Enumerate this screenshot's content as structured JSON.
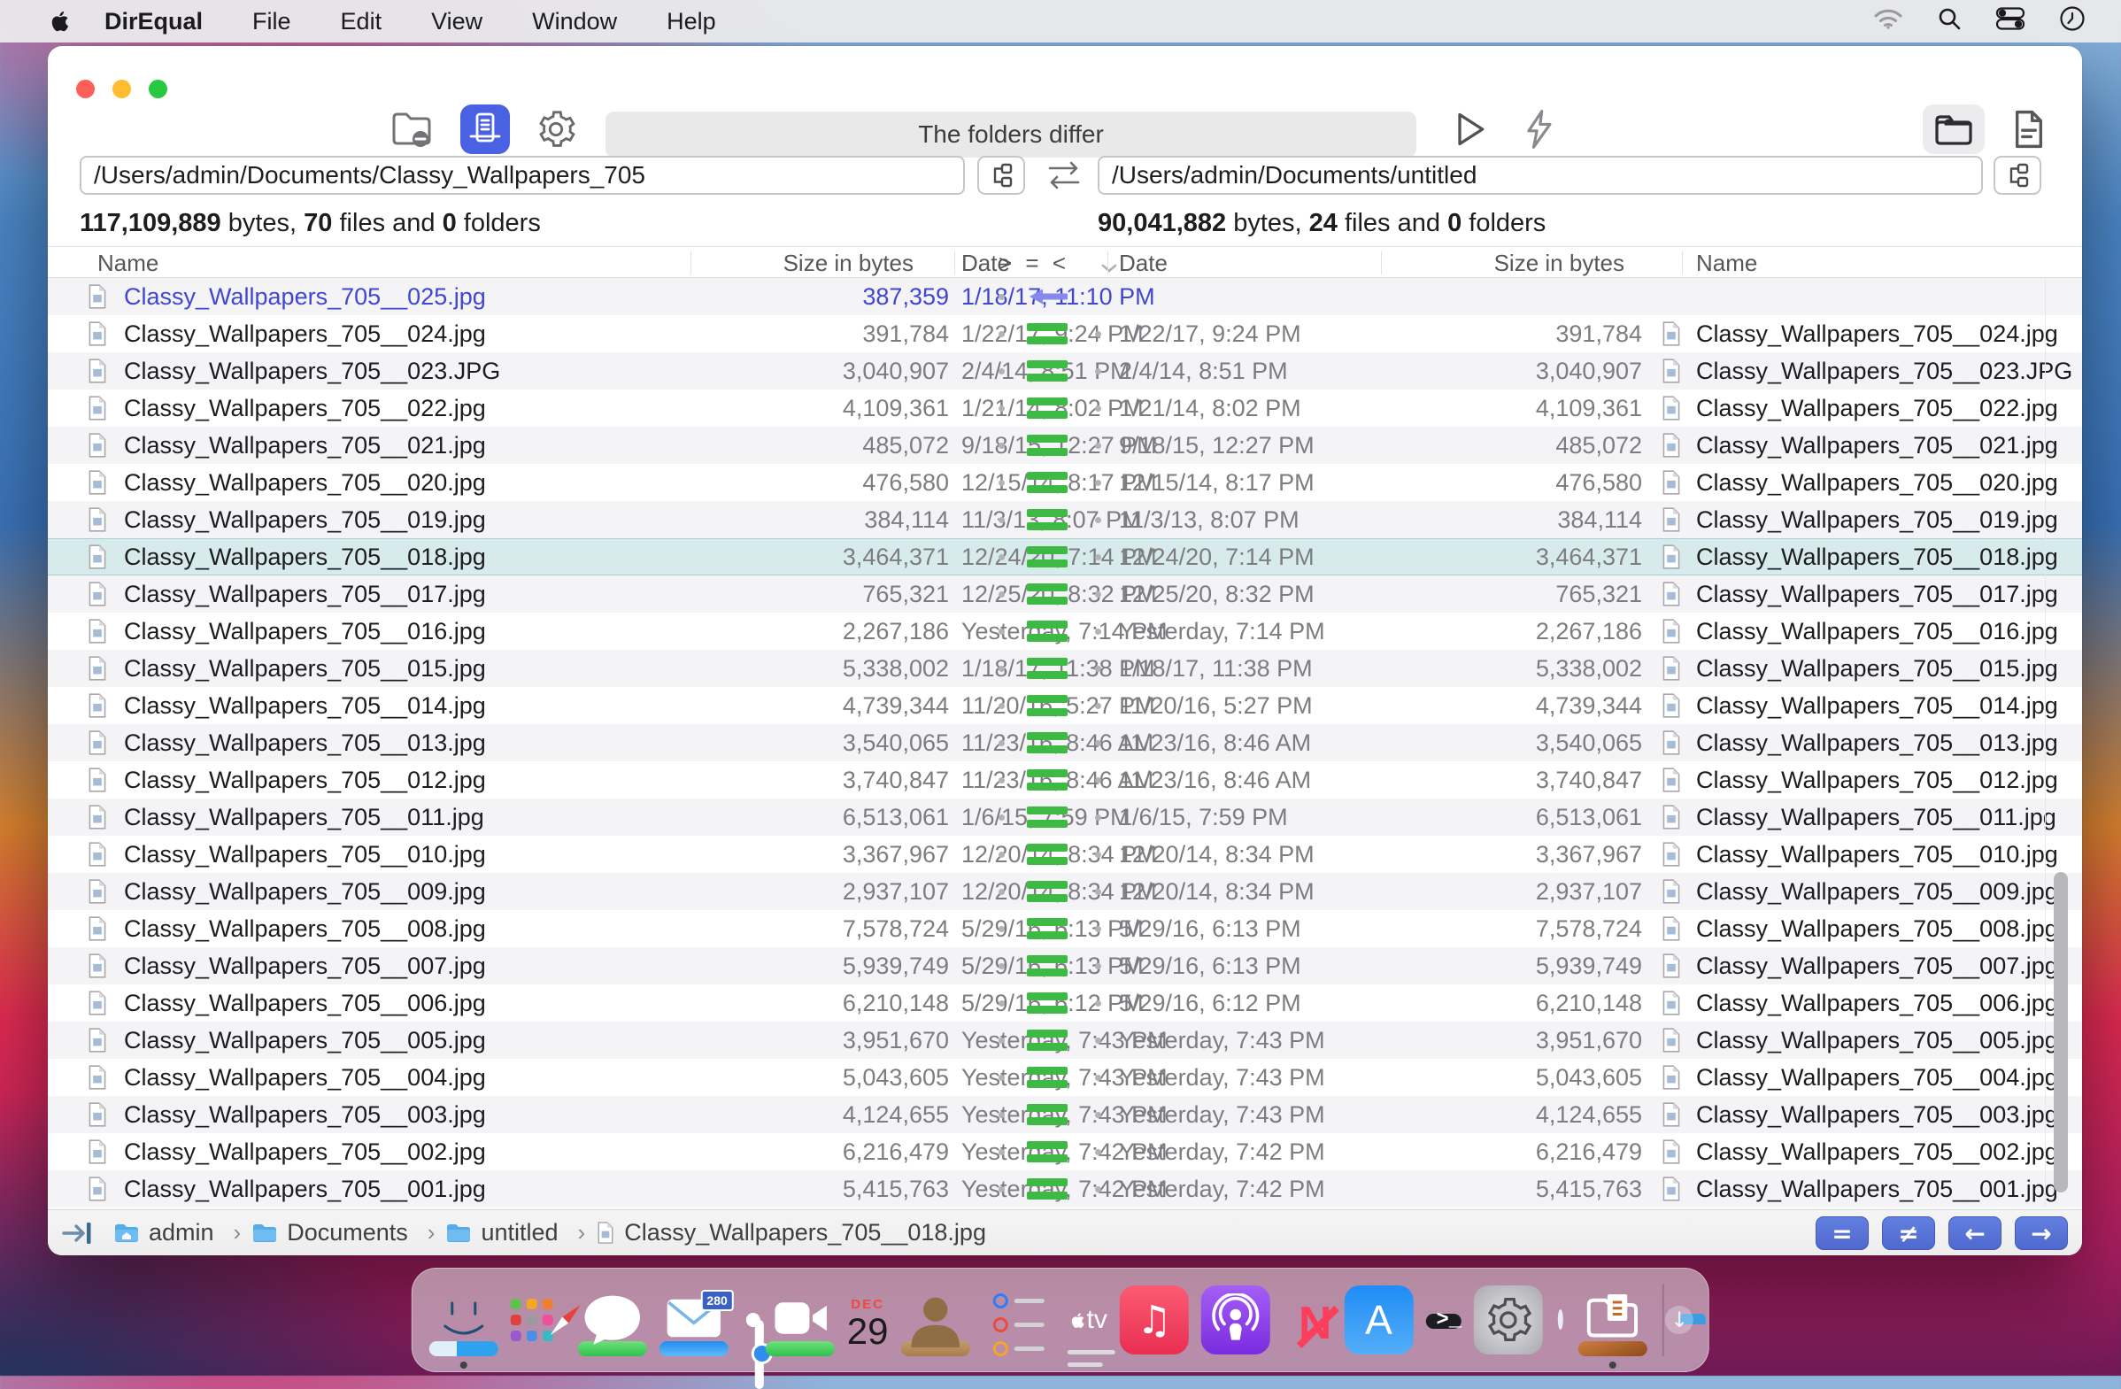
{
  "menu_bar": {
    "app_name": "DirEqual",
    "items": [
      "File",
      "Edit",
      "View",
      "Window",
      "Help"
    ]
  },
  "toolbar": {
    "status_title": "The folders differ"
  },
  "panes": {
    "left": {
      "path": "/Users/admin/Documents/Classy_Wallpapers_705",
      "bytes": "117,109,889",
      "bytes_label": "bytes,",
      "files": "70",
      "files_label": "files and",
      "folders": "0",
      "folders_label": "folders"
    },
    "right": {
      "path": "/Users/admin/Documents/untitled",
      "bytes": "90,041,882",
      "bytes_label": "bytes,",
      "files": "24",
      "files_label": "files and",
      "folders": "0",
      "folders_label": "folders"
    }
  },
  "table": {
    "headers": {
      "name_left": "Name",
      "size_left": "Size in bytes",
      "date_left": "Date",
      "compare": "> = <",
      "date_right": "Date",
      "size_right": "Size in bytes",
      "name_right": "Name"
    },
    "rows": [
      {
        "name": "Classy_Wallpapers_705__025.jpg",
        "size": "387,359",
        "date": "1/18/17, 11:10 PM",
        "status": "left-only",
        "selected": false
      },
      {
        "name": "Classy_Wallpapers_705__024.jpg",
        "size": "391,784",
        "date": "1/22/17, 9:24 PM",
        "status": "equal",
        "selected": false
      },
      {
        "name": "Classy_Wallpapers_705__023.JPG",
        "size": "3,040,907",
        "date": "2/4/14, 8:51 PM",
        "status": "equal",
        "selected": false
      },
      {
        "name": "Classy_Wallpapers_705__022.jpg",
        "size": "4,109,361",
        "date": "1/21/14, 8:02 PM",
        "status": "equal",
        "selected": false
      },
      {
        "name": "Classy_Wallpapers_705__021.jpg",
        "size": "485,072",
        "date": "9/18/15, 12:27 PM",
        "status": "equal",
        "selected": false
      },
      {
        "name": "Classy_Wallpapers_705__020.jpg",
        "size": "476,580",
        "date": "12/15/14, 8:17 PM",
        "status": "equal",
        "selected": false
      },
      {
        "name": "Classy_Wallpapers_705__019.jpg",
        "size": "384,114",
        "date": "11/3/13, 8:07 PM",
        "status": "equal",
        "selected": false
      },
      {
        "name": "Classy_Wallpapers_705__018.jpg",
        "size": "3,464,371",
        "date": "12/24/20, 7:14 PM",
        "status": "equal",
        "selected": true
      },
      {
        "name": "Classy_Wallpapers_705__017.jpg",
        "size": "765,321",
        "date": "12/25/20, 8:32 PM",
        "status": "equal",
        "selected": false
      },
      {
        "name": "Classy_Wallpapers_705__016.jpg",
        "size": "2,267,186",
        "date": "Yesterday, 7:14 PM",
        "status": "equal",
        "selected": false
      },
      {
        "name": "Classy_Wallpapers_705__015.jpg",
        "size": "5,338,002",
        "date": "1/18/17, 11:38 PM",
        "status": "equal",
        "selected": false
      },
      {
        "name": "Classy_Wallpapers_705__014.jpg",
        "size": "4,739,344",
        "date": "11/20/16, 5:27 PM",
        "status": "equal",
        "selected": false
      },
      {
        "name": "Classy_Wallpapers_705__013.jpg",
        "size": "3,540,065",
        "date": "11/23/16, 8:46 AM",
        "status": "equal",
        "selected": false
      },
      {
        "name": "Classy_Wallpapers_705__012.jpg",
        "size": "3,740,847",
        "date": "11/23/16, 8:46 AM",
        "status": "equal",
        "selected": false
      },
      {
        "name": "Classy_Wallpapers_705__011.jpg",
        "size": "6,513,061",
        "date": "1/6/15, 7:59 PM",
        "status": "equal",
        "selected": false
      },
      {
        "name": "Classy_Wallpapers_705__010.jpg",
        "size": "3,367,967",
        "date": "12/20/14, 8:34 PM",
        "status": "equal",
        "selected": false
      },
      {
        "name": "Classy_Wallpapers_705__009.jpg",
        "size": "2,937,107",
        "date": "12/20/14, 8:34 PM",
        "status": "equal",
        "selected": false
      },
      {
        "name": "Classy_Wallpapers_705__008.jpg",
        "size": "7,578,724",
        "date": "5/29/16, 6:13 PM",
        "status": "equal",
        "selected": false
      },
      {
        "name": "Classy_Wallpapers_705__007.jpg",
        "size": "5,939,749",
        "date": "5/29/16, 6:13 PM",
        "status": "equal",
        "selected": false
      },
      {
        "name": "Classy_Wallpapers_705__006.jpg",
        "size": "6,210,148",
        "date": "5/29/16, 6:12 PM",
        "status": "equal",
        "selected": false
      },
      {
        "name": "Classy_Wallpapers_705__005.jpg",
        "size": "3,951,670",
        "date": "Yesterday, 7:43 PM",
        "status": "equal",
        "selected": false
      },
      {
        "name": "Classy_Wallpapers_705__004.jpg",
        "size": "5,043,605",
        "date": "Yesterday, 7:43 PM",
        "status": "equal",
        "selected": false
      },
      {
        "name": "Classy_Wallpapers_705__003.jpg",
        "size": "4,124,655",
        "date": "Yesterday, 7:43 PM",
        "status": "equal",
        "selected": false
      },
      {
        "name": "Classy_Wallpapers_705__002.jpg",
        "size": "6,216,479",
        "date": "Yesterday, 7:42 PM",
        "status": "equal",
        "selected": false
      },
      {
        "name": "Classy_Wallpapers_705__001.jpg",
        "size": "5,415,763",
        "date": "Yesterday, 7:42 PM",
        "status": "equal",
        "selected": false
      }
    ]
  },
  "status_bar": {
    "separator": "›",
    "breadcrumb": [
      {
        "label": "admin"
      },
      {
        "label": "Documents"
      },
      {
        "label": "untitled"
      },
      {
        "label": "Classy_Wallpapers_705__018.jpg"
      }
    ],
    "buttons": {
      "equal": "=",
      "not_equal": "≠",
      "prev": "←",
      "next": "→"
    }
  },
  "dock": {
    "calendar_month": "DEC",
    "calendar_day": "29",
    "maps_badge": "280",
    "appletv_label": "tv",
    "terminal_prompt": ">_",
    "news_letter": "N",
    "appstore_letter": "A",
    "music_note": "♫",
    "downloads_arrow": "↓"
  },
  "colors": {
    "accent_blue": "#4a61e4",
    "nav_button_blue": "#5b76d7",
    "equal_green": "#3cba44",
    "left_only_text": "#4046d2",
    "arrow_purple": "#8589ec",
    "selected_row": "#d8ebec"
  }
}
